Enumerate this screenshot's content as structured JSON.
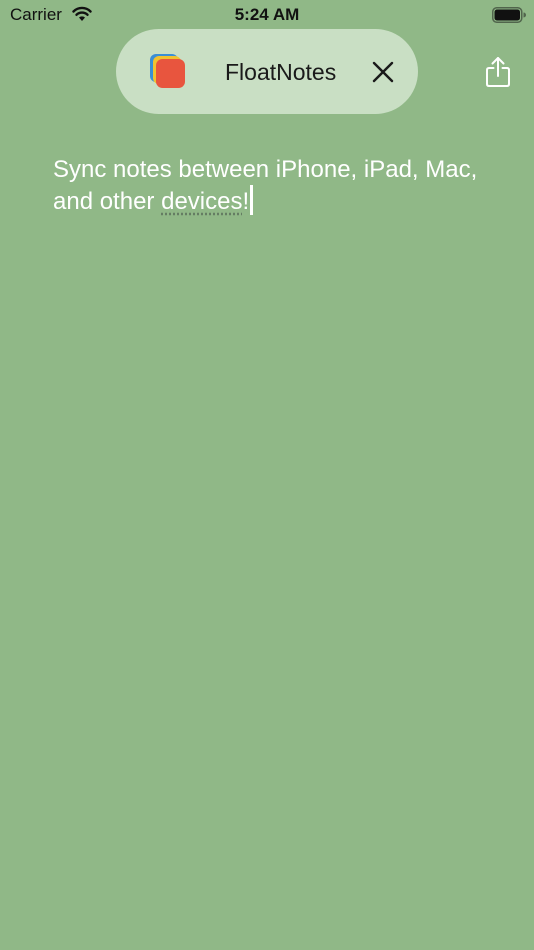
{
  "status_bar": {
    "carrier": "Carrier",
    "time": "5:24 AM",
    "wifi_icon": "wifi-icon",
    "battery_icon": "battery-icon"
  },
  "header": {
    "app_name": "FloatNotes",
    "app_icon": "floatnotes-app-icon",
    "close_icon": "close-icon",
    "share_icon": "share-icon"
  },
  "note": {
    "line1": "Sync notes between iPhone, iPad, Mac,",
    "line2_prefix": "and other ",
    "line2_word": "devices",
    "line2_suffix": "!"
  },
  "colors": {
    "background": "#90b887",
    "pill": "#c9dfc4",
    "app_icon_front": "#e8553e",
    "text": "#ffffff"
  }
}
